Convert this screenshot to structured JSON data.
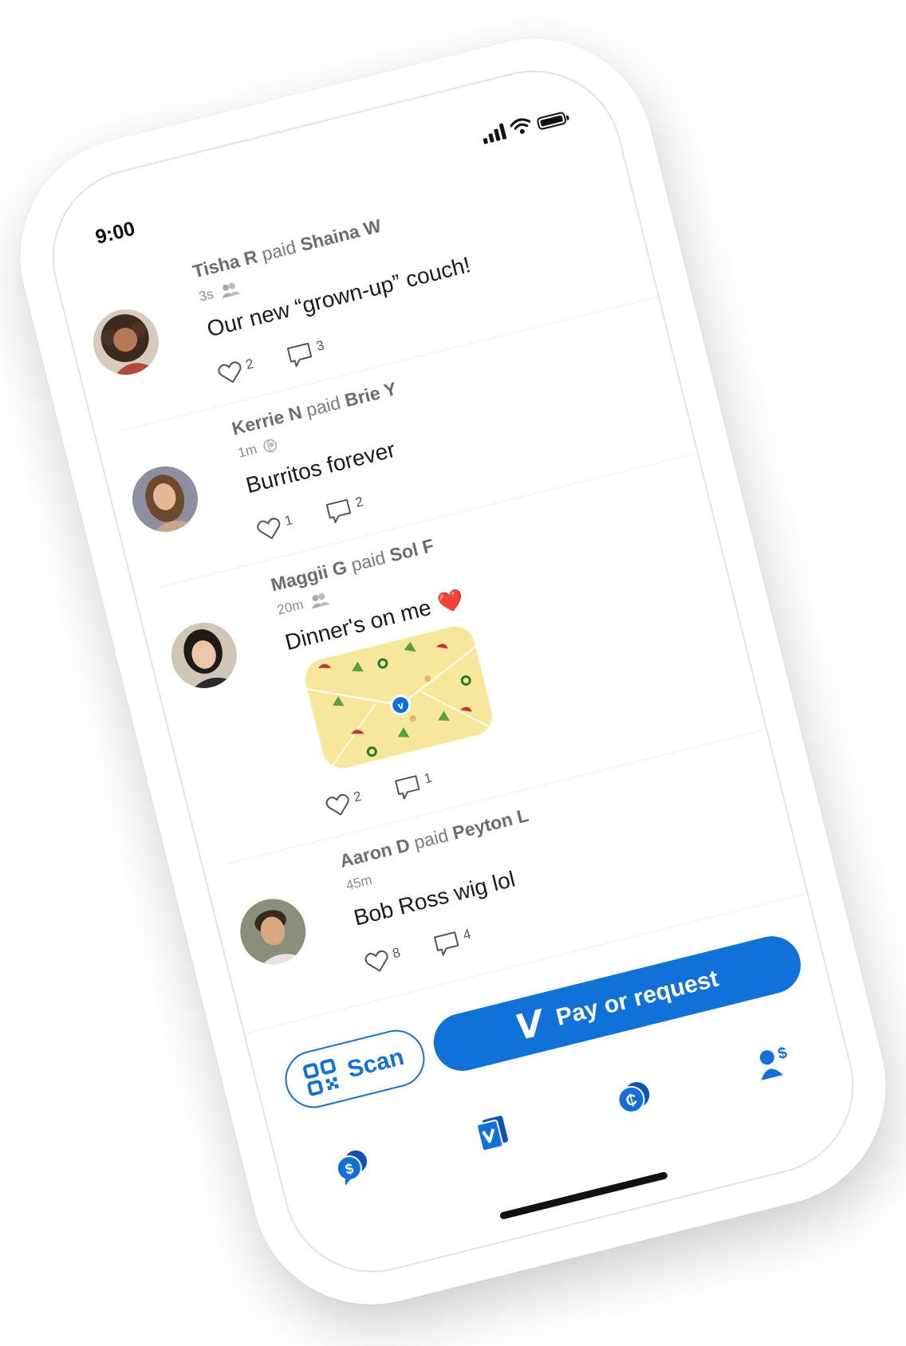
{
  "status_bar": {
    "time": "9:00"
  },
  "feed": [
    {
      "payer": "Tisha R",
      "verb": "paid",
      "payee": "Shaina W",
      "time": "3s",
      "privacy_icon": "friends-icon",
      "message": "Our new “grown-up” couch!",
      "likes": "2",
      "comments": "3"
    },
    {
      "payer": "Kerrie N",
      "verb": "paid",
      "payee": "Brie Y",
      "time": "1m",
      "privacy_icon": "globe-icon",
      "message": "Burritos forever",
      "likes": "1",
      "comments": "2"
    },
    {
      "payer": "Maggii G",
      "verb": "paid",
      "payee": "Sol F",
      "time": "20m",
      "privacy_icon": "friends-icon",
      "message": "Dinner's on me",
      "emoji": "❤️",
      "likes": "2",
      "comments": "1"
    },
    {
      "payer": "Aaron D",
      "verb": "paid",
      "payee": "Peyton L",
      "time": "45m",
      "message": "Bob Ross wig lol",
      "likes": "8",
      "comments": "4"
    }
  ],
  "bottom_bar": {
    "scan_label": "Scan",
    "pay_label": "Pay or request",
    "pay_logo": "V",
    "tabs": [
      "home-icon",
      "cards-icon",
      "crypto-icon",
      "me-icon"
    ]
  },
  "colors": {
    "accent": "#1072d9",
    "text": "#1a1a1a",
    "muted": "#7a7a7a"
  }
}
